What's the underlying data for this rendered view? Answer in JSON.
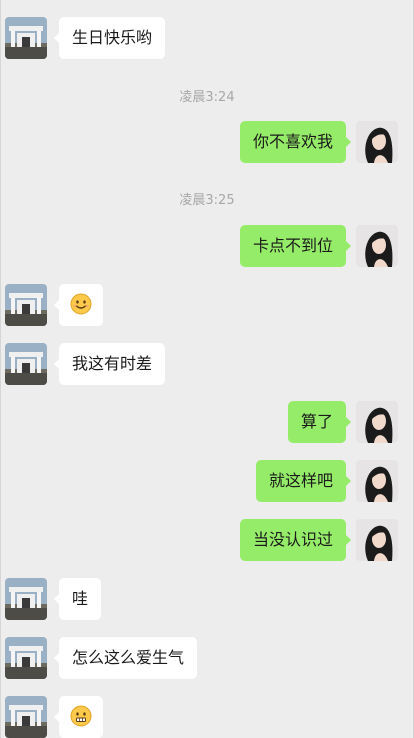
{
  "messages": [
    {
      "side": "left",
      "text": "生日快乐哟"
    },
    {
      "time": "凌晨3:24"
    },
    {
      "side": "right",
      "text": "你不喜欢我"
    },
    {
      "time": "凌晨3:25"
    },
    {
      "side": "right",
      "text": "卡点不到位"
    },
    {
      "side": "left",
      "emoji": "smile-emoji"
    },
    {
      "side": "left",
      "text": "我这有时差"
    },
    {
      "side": "right",
      "text": "算了"
    },
    {
      "side": "right",
      "text": "就这样吧"
    },
    {
      "side": "right",
      "text": "当没认识过"
    },
    {
      "side": "left",
      "text": "哇"
    },
    {
      "side": "left",
      "text": "怎么这么爱生气"
    },
    {
      "side": "left",
      "emoji": "awkward-emoji"
    }
  ],
  "colors": {
    "background": "#ededed",
    "sent_bubble": "#95ec69",
    "received_bubble": "#ffffff",
    "timestamp": "#a8a8a8"
  },
  "icons": {
    "left_avatar": "building-gate-avatar",
    "right_avatar": "girl-portrait-avatar"
  }
}
